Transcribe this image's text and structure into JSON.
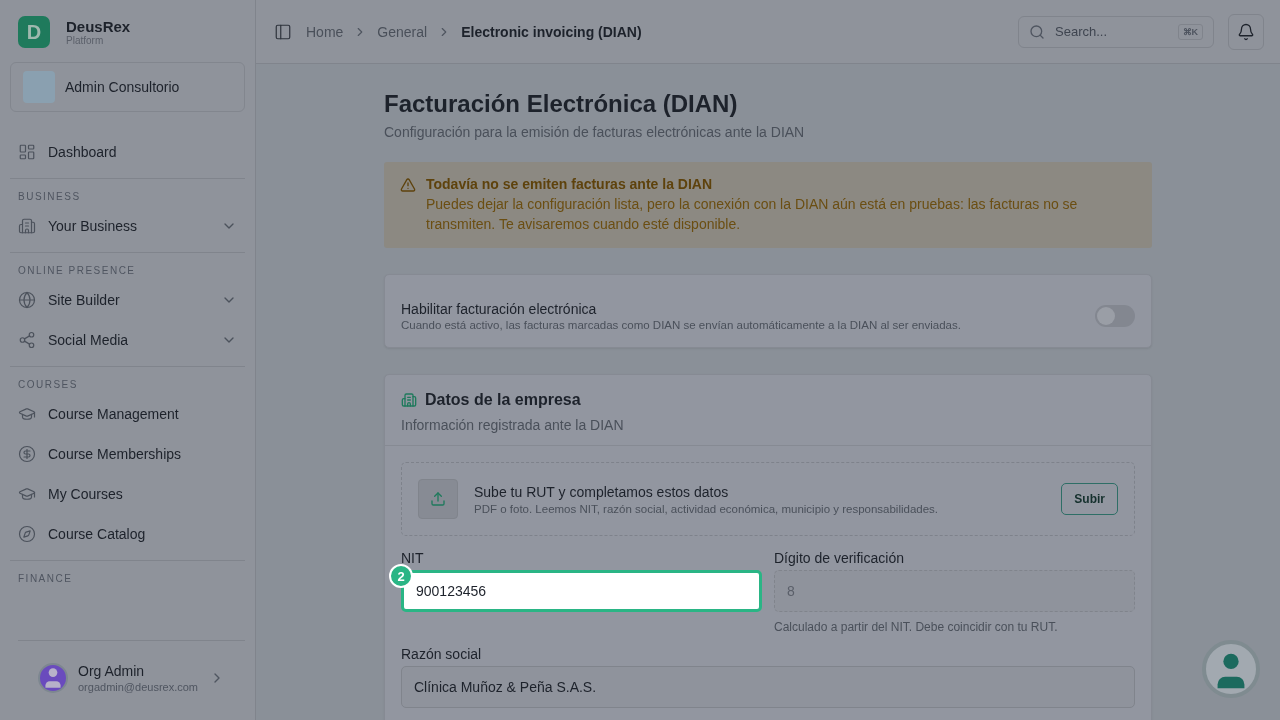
{
  "brand": {
    "logo_letter": "D",
    "name": "DeusRex",
    "subtitle": "Platform"
  },
  "organization": {
    "name": "Admin Consultorio"
  },
  "nav": [
    {
      "items": [
        {
          "label": "Dashboard"
        }
      ]
    },
    {
      "title": "BUSINESS",
      "items": [
        {
          "label": "Your Business",
          "expanded": false
        }
      ]
    },
    {
      "title": "ONLINE PRESENCE",
      "items": [
        {
          "label": "Site Builder",
          "expanded": false
        },
        {
          "label": "Social Media",
          "expanded": false
        }
      ]
    },
    {
      "title": "COURSES",
      "items": [
        {
          "label": "Course Management"
        },
        {
          "label": "Course Memberships"
        },
        {
          "label": "My Courses"
        },
        {
          "label": "Course Catalog"
        }
      ]
    },
    {
      "title": "FINANCE"
    }
  ],
  "user": {
    "name": "Org Admin",
    "email": "orgadmin@deusrex.com"
  },
  "breadcrumbs": [
    {
      "label": "Home",
      "current": false
    },
    {
      "label": "General",
      "current": false
    },
    {
      "label": "Electronic invoicing (DIAN)",
      "current": true
    }
  ],
  "search": {
    "placeholder": "Search...",
    "shortcut": "⌘K"
  },
  "page": {
    "title": "Facturación Electrónica (DIAN)",
    "subtitle": "Configuración para la emisión de facturas electrónicas ante la DIAN"
  },
  "alert": {
    "title": "Todavía no se emiten facturas ante la DIAN",
    "message": "Puedes dejar la configuración lista, pero la conexión con la DIAN aún está en pruebas: las facturas no se transmiten. Te avisaremos cuando esté disponible."
  },
  "toggle_card": {
    "title": "Habilitar facturación electrónica",
    "description": "Cuando está activo, las facturas marcadas como DIAN se envían automáticamente a la DIAN al ser enviadas.",
    "on": false
  },
  "company": {
    "title": "Datos de la empresa",
    "subtitle": "Información registrada ante la DIAN",
    "upload": {
      "title": "Sube tu RUT y completamos estos datos",
      "description": "PDF o foto. Leemos NIT, razón social, actividad económica, municipio y responsabilidades.",
      "button": "Subir"
    },
    "fields": [
      {
        "label": "NIT",
        "value": "900123456",
        "disabled": false,
        "focused": true,
        "step": "2"
      },
      {
        "label": "Dígito de verificación",
        "value": "8",
        "disabled": true,
        "focused": false,
        "help": "Calculado a partir del NIT. Debe coincidir con tu RUT."
      },
      {
        "label": "Razón social",
        "value": "Clínica Muñoz & Peña S.A.S.",
        "disabled": false,
        "focused": false
      }
    ]
  }
}
